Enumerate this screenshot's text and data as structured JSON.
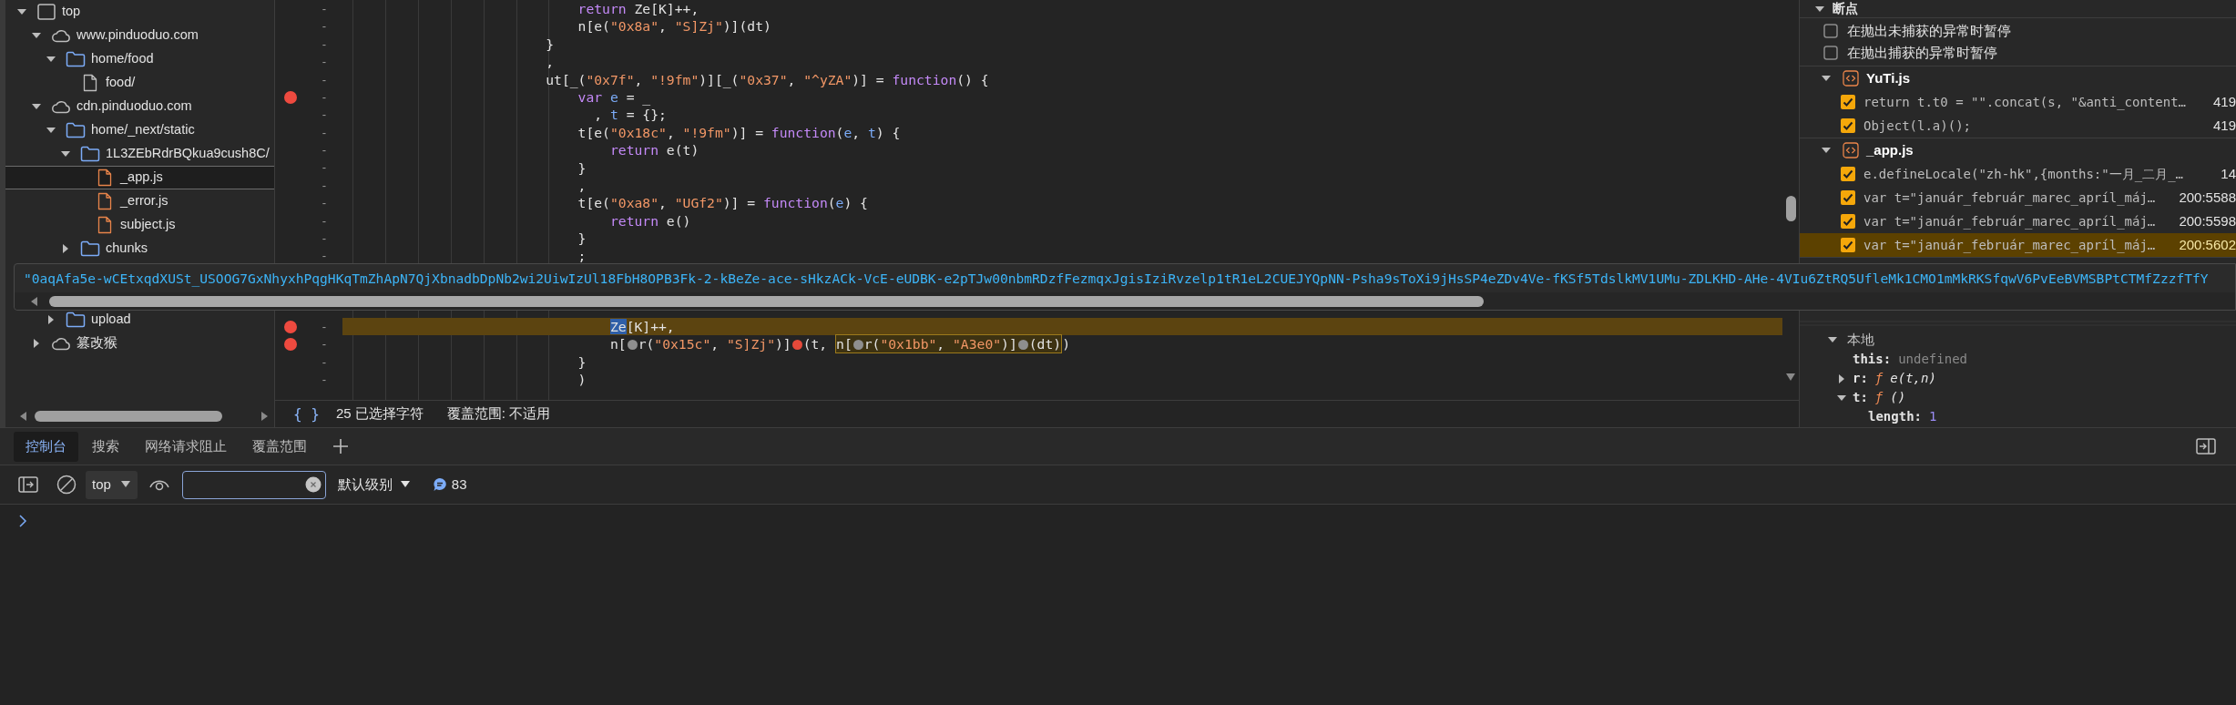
{
  "file_tree": {
    "items": [
      {
        "label": "top",
        "kind": "frame",
        "expanded": true,
        "selected": false,
        "children": [
          {
            "label": "www.pinduoduo.com",
            "kind": "domain",
            "expanded": true,
            "selected": false,
            "children": [
              {
                "label": "home/food",
                "kind": "folder",
                "expanded": true,
                "selected": false,
                "children": [
                  {
                    "label": "food/",
                    "kind": "document",
                    "selected": false
                  }
                ]
              }
            ]
          },
          {
            "label": "cdn.pinduoduo.com",
            "kind": "domain",
            "expanded": true,
            "selected": false,
            "children": [
              {
                "label": "home/_next/static",
                "kind": "folder",
                "expanded": true,
                "selected": false,
                "children": [
                  {
                    "label": "1L3ZEbRdrBQkua9cush8C/",
                    "kind": "folder",
                    "expanded": true,
                    "selected": false,
                    "children": [
                      {
                        "label": "_app.js",
                        "kind": "script",
                        "selected": true
                      },
                      {
                        "label": "_error.js",
                        "kind": "script",
                        "selected": false
                      },
                      {
                        "label": "subject.js",
                        "kind": "script",
                        "selected": false
                      }
                    ]
                  },
                  {
                    "label": "chunks",
                    "kind": "folder",
                    "expanded": false,
                    "selected": false
                  }
                ]
              },
              {
                "label": "upload",
                "kind": "folder",
                "expanded": false,
                "selected": false
              }
            ]
          },
          {
            "label": "篡改猴",
            "kind": "domain",
            "expanded": false,
            "selected": false
          }
        ]
      }
    ]
  },
  "editor": {
    "lines": [
      {
        "number": "-",
        "breakpoint": false,
        "paused": false,
        "tokens": [
          {
            "kind": "keyword",
            "text": "                            return"
          },
          {
            "kind": "plain",
            "text": " Ze[K]++,"
          }
        ]
      },
      {
        "number": "-",
        "breakpoint": false,
        "paused": false,
        "tokens": [
          {
            "kind": "plain",
            "text": "                            n[e("
          },
          {
            "kind": "string",
            "text": "\"0x8a\""
          },
          {
            "kind": "plain",
            "text": ", "
          },
          {
            "kind": "string",
            "text": "\"S]Zj\""
          },
          {
            "kind": "plain",
            "text": ")](dt)"
          }
        ]
      },
      {
        "number": "-",
        "breakpoint": false,
        "paused": false,
        "tokens": [
          {
            "kind": "plain",
            "text": "                        }"
          }
        ]
      },
      {
        "number": "-",
        "breakpoint": false,
        "paused": false,
        "tokens": [
          {
            "kind": "plain",
            "text": "                        ,"
          }
        ]
      },
      {
        "number": "-",
        "breakpoint": false,
        "paused": false,
        "tokens": [
          {
            "kind": "plain",
            "text": "                        ut[_("
          },
          {
            "kind": "string",
            "text": "\"0x7f\""
          },
          {
            "kind": "plain",
            "text": ", "
          },
          {
            "kind": "string",
            "text": "\"!9fm\""
          },
          {
            "kind": "plain",
            "text": ")][_("
          },
          {
            "kind": "string",
            "text": "\"0x37\""
          },
          {
            "kind": "plain",
            "text": ", "
          },
          {
            "kind": "string",
            "text": "\"^yZA\""
          },
          {
            "kind": "plain",
            "text": ")] = "
          },
          {
            "kind": "keyword",
            "text": "function"
          },
          {
            "kind": "plain",
            "text": "() {"
          }
        ]
      },
      {
        "number": "-",
        "breakpoint": true,
        "paused": false,
        "tokens": [
          {
            "kind": "keyword",
            "text": "                            var"
          },
          {
            "kind": "param",
            "text": " e"
          },
          {
            "kind": "plain",
            "text": " = _"
          }
        ]
      },
      {
        "number": "-",
        "breakpoint": false,
        "paused": false,
        "tokens": [
          {
            "kind": "plain",
            "text": "                              , "
          },
          {
            "kind": "param",
            "text": "t"
          },
          {
            "kind": "plain",
            "text": " = {};"
          }
        ]
      },
      {
        "number": "-",
        "breakpoint": false,
        "paused": false,
        "tokens": [
          {
            "kind": "plain",
            "text": "                            t[e("
          },
          {
            "kind": "string",
            "text": "\"0x18c\""
          },
          {
            "kind": "plain",
            "text": ", "
          },
          {
            "kind": "string",
            "text": "\"!9fm\""
          },
          {
            "kind": "plain",
            "text": ")] = "
          },
          {
            "kind": "keyword",
            "text": "function"
          },
          {
            "kind": "plain",
            "text": "("
          },
          {
            "kind": "param",
            "text": "e"
          },
          {
            "kind": "plain",
            "text": ", "
          },
          {
            "kind": "param",
            "text": "t"
          },
          {
            "kind": "plain",
            "text": ") {"
          }
        ]
      },
      {
        "number": "-",
        "breakpoint": false,
        "paused": false,
        "tokens": [
          {
            "kind": "keyword",
            "text": "                                return"
          },
          {
            "kind": "plain",
            "text": " e(t)"
          }
        ]
      },
      {
        "number": "-",
        "breakpoint": false,
        "paused": false,
        "tokens": [
          {
            "kind": "plain",
            "text": "                            }"
          }
        ]
      },
      {
        "number": "-",
        "breakpoint": false,
        "paused": false,
        "tokens": [
          {
            "kind": "plain",
            "text": "                            ,"
          }
        ]
      },
      {
        "number": "-",
        "breakpoint": false,
        "paused": false,
        "tokens": [
          {
            "kind": "plain",
            "text": "                            t[e("
          },
          {
            "kind": "string",
            "text": "\"0xa8\""
          },
          {
            "kind": "plain",
            "text": ", "
          },
          {
            "kind": "string",
            "text": "\"UGf2\""
          },
          {
            "kind": "plain",
            "text": ")] = "
          },
          {
            "kind": "keyword",
            "text": "function"
          },
          {
            "kind": "plain",
            "text": "("
          },
          {
            "kind": "param",
            "text": "e"
          },
          {
            "kind": "plain",
            "text": ") {"
          }
        ]
      },
      {
        "number": "-",
        "breakpoint": false,
        "paused": false,
        "tokens": [
          {
            "kind": "keyword",
            "text": "                                return"
          },
          {
            "kind": "plain",
            "text": " e()"
          }
        ]
      },
      {
        "number": "-",
        "breakpoint": false,
        "paused": false,
        "tokens": [
          {
            "kind": "plain",
            "text": "                            }"
          }
        ]
      },
      {
        "number": "-",
        "breakpoint": false,
        "paused": false,
        "tokens": [
          {
            "kind": "plain",
            "text": "                            ;"
          }
        ]
      },
      {
        "number": "-",
        "breakpoint": true,
        "paused": true,
        "tokens": [
          {
            "kind": "selected",
            "text": "                                Ze"
          },
          {
            "kind": "plain",
            "text": "[K]++,"
          }
        ]
      },
      {
        "number": "-",
        "breakpoint": true,
        "paused": false,
        "tokens": [
          {
            "kind": "plain",
            "text": "                                n["
          },
          {
            "kind": "inline_bp",
            "active": false
          },
          {
            "kind": "plain",
            "text": "r("
          },
          {
            "kind": "string",
            "text": "\"0x15c\""
          },
          {
            "kind": "plain",
            "text": ", "
          },
          {
            "kind": "string",
            "text": "\"S]Zj\""
          },
          {
            "kind": "plain",
            "text": ")]"
          },
          {
            "kind": "inline_bp",
            "active": true
          },
          {
            "kind": "plain",
            "text": "(t, "
          },
          {
            "kind": "hover",
            "tokens": [
              {
                "kind": "plain",
                "text": "n["
              },
              {
                "kind": "inline_bp",
                "active": false
              },
              {
                "kind": "plain",
                "text": "r("
              },
              {
                "kind": "string",
                "text": "\"0x1bb\""
              },
              {
                "kind": "plain",
                "text": ", "
              },
              {
                "kind": "string",
                "text": "\"A3e0\""
              },
              {
                "kind": "plain",
                "text": ")]"
              },
              {
                "kind": "inline_bp",
                "active": false
              },
              {
                "kind": "plain",
                "text": "(dt)"
              }
            ]
          },
          {
            "kind": "plain",
            "text": ")"
          }
        ]
      },
      {
        "number": "-",
        "breakpoint": false,
        "paused": false,
        "tokens": [
          {
            "kind": "plain",
            "text": "                            }"
          }
        ]
      },
      {
        "number": "-",
        "breakpoint": false,
        "paused": false,
        "tokens": [
          {
            "kind": "plain",
            "text": "                            )"
          }
        ]
      }
    ],
    "hover_value": "\"0aqAfa5e-wCEtxqdXUSt_USOOG7GxNhyxhPqgHKqTmZhApN7QjXbnadbDpNb2wi2UiwIzUl18FbH8OPB3Fk-2-kBeZe-ace-sHkzACk-VcE-eUDBK-e2pTJw00nbmRDzfFezmqxJgisIziRvzelp1tR1eL2CUEJYQpNN-Psha9sToXi9jHsSP4eZDv4Ve-fKSf5TdslkMV1UMu-ZDLKHD-AHe-4VIu6ZtRQ5UfleMk1CMO1mMkRKSfqwV6PvEeBVMSBPtCTMfZzzfTfY"
  },
  "status_bar": {
    "pretty_print": "{ }",
    "selection": "25 已选择字符",
    "coverage": "覆盖范围: 不适用"
  },
  "sidebar": {
    "breakpoints_title": "断点",
    "expanded": true,
    "pause_options": [
      {
        "label": "在抛出未捕获的异常时暂停",
        "checked": false
      },
      {
        "label": "在抛出捕获的异常时暂停",
        "checked": false
      }
    ],
    "files": [
      {
        "name": "YuTi.js",
        "expanded": true,
        "breakpoints": [
          {
            "code": "return t.t0 = \"\".concat(s, \"&anti_content…",
            "location": "419",
            "checked": true,
            "selected": false
          },
          {
            "code": "Object(l.a)();",
            "location": "419",
            "checked": true,
            "selected": false
          }
        ]
      },
      {
        "name": "_app.js",
        "expanded": true,
        "breakpoints": [
          {
            "code": "e.defineLocale(\"zh-hk\",{months:\"一月_二月_…",
            "location": "14",
            "checked": true,
            "selected": false
          },
          {
            "code": "var t=\"január_február_marec_apríl_máj…",
            "location": "200:5588",
            "checked": true,
            "selected": false
          },
          {
            "code": "var t=\"január_február_marec_apríl_máj…",
            "location": "200:5598",
            "checked": true,
            "selected": false
          },
          {
            "code": "var t=\"január_február_marec_apríl_máj…",
            "location": "200:5602",
            "checked": true,
            "selected": true
          }
        ]
      }
    ],
    "scope": {
      "title": "本地",
      "expanded": true,
      "vars": [
        {
          "name": "this:",
          "value": "undefined",
          "kind": "value"
        },
        {
          "name": "r:",
          "sign": "ƒ",
          "value": "e(t,n)",
          "kind": "function",
          "expanded": false
        },
        {
          "name": "t:",
          "sign": "ƒ",
          "value": "()",
          "kind": "function",
          "expanded": true
        },
        {
          "name": "length:",
          "value": "1",
          "kind": "number",
          "child": true
        }
      ]
    }
  },
  "drawer": {
    "tabs": [
      {
        "label": "控制台",
        "selected": true
      },
      {
        "label": "搜索",
        "selected": false
      },
      {
        "label": "网络请求阻止",
        "selected": false
      },
      {
        "label": "覆盖范围",
        "selected": false
      }
    ],
    "toolbar": {
      "context": "top",
      "level": "默认级别",
      "message_count": "83"
    }
  }
}
